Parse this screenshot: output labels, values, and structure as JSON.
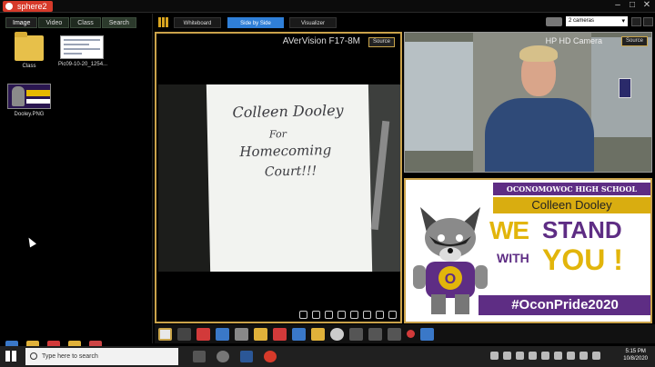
{
  "app": {
    "title": "sphere2"
  },
  "window_controls": [
    "–",
    "□",
    "✕"
  ],
  "sidebar": {
    "tabs": [
      {
        "label": "Image"
      },
      {
        "label": "Video"
      },
      {
        "label": "Class"
      },
      {
        "label": "Search"
      }
    ],
    "files": [
      {
        "label": "Class",
        "icon": "folder-icon"
      },
      {
        "label": "Pic09-10-20_1254...",
        "icon": "document-thumbnail"
      },
      {
        "label": "Dooley.PNG",
        "icon": "image-thumbnail"
      }
    ]
  },
  "main_tabs": [
    {
      "label": "Whiteboard"
    },
    {
      "label": "Side by Side"
    },
    {
      "label": "Visualizer"
    }
  ],
  "camera_select": {
    "value": "2 cameras"
  },
  "document_camera": {
    "title": "AVerVision F17-8M",
    "source_label": "Source"
  },
  "document_text": [
    "Colleen Dooley",
    "For",
    "Homecoming",
    "Court!!!"
  ],
  "webcam": {
    "title": "HP HD Camera",
    "source_label": "Source"
  },
  "pride_graphic": {
    "school": "OCONOMOWOC HIGH SCHOOL",
    "name": "Colleen Dooley",
    "we": "WE",
    "stand": "STAND",
    "with": "WITH",
    "you": "YOU !",
    "hashtag": "#OconPride2020",
    "mascot_letter": "O"
  },
  "taskbar": {
    "search_placeholder": "Type here to search",
    "time": "5:15 PM",
    "date": "10/8/2020"
  },
  "colors": {
    "accent": "#caa24a",
    "brand_red": "#d63a2a",
    "purple": "#5e2d84",
    "gold": "#e2b50b",
    "tab_active": "#2f7fd8"
  }
}
